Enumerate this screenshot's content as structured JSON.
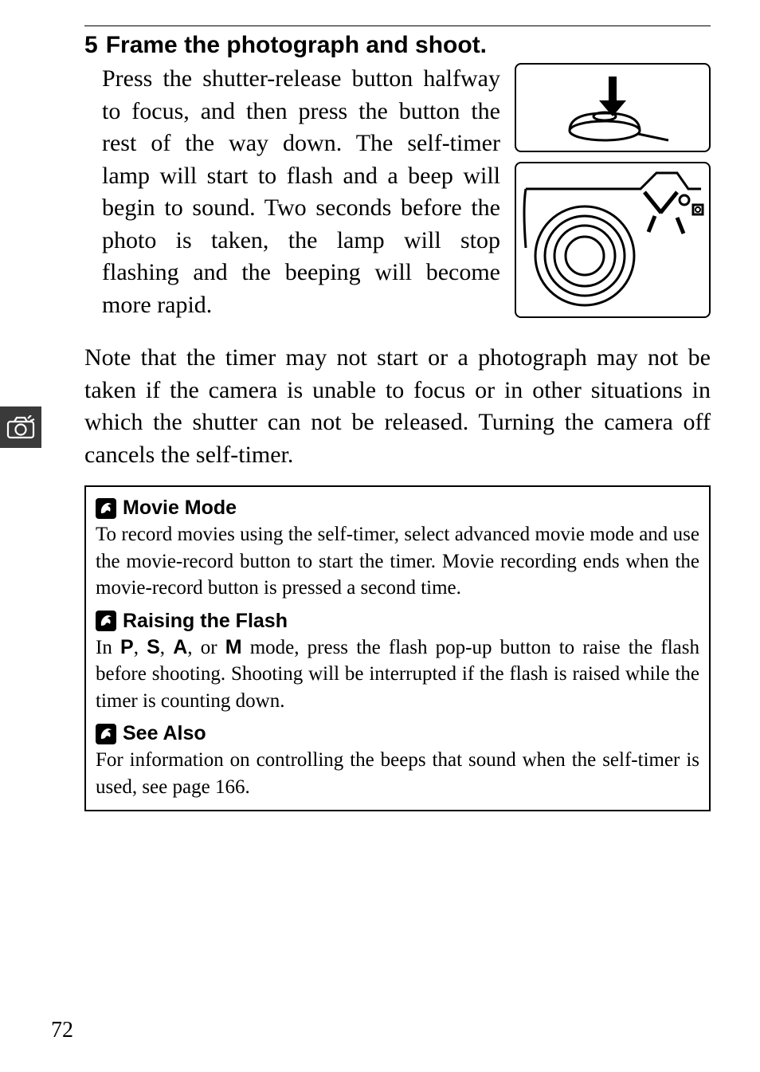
{
  "step": {
    "number": "5",
    "heading": "Frame the photograph and shoot.",
    "body": "Press the shutter-release button halfway to focus, and then press the button the rest of the way down. The self-timer lamp will start to flash and a beep will begin to sound. Two seconds before the photo is taken, the lamp will stop flashing and the beeping will become more rapid."
  },
  "note": "Note that the timer may not start or a photograph may not be taken if the camera is unable to focus or in other situations in which the shutter can not be released. Turning the camera off cancels the self-timer.",
  "info": {
    "movie": {
      "title": "Movie Mode",
      "body": "To record movies using the self-timer, select advanced movie mode and use the movie-record button to start the timer. Movie recording ends when the movie-record button is pressed a second time."
    },
    "flash": {
      "title": "Raising the Flash",
      "body_prefix": "In ",
      "m1": "P",
      "c1": ", ",
      "m2": "S",
      "c2": ", ",
      "m3": "A",
      "c3": ", or ",
      "m4": "M",
      "body_suffix": " mode, press the flash pop-up button to raise the flash before shooting. Shooting will be interrupted if the flash is raised while the timer is counting down."
    },
    "seealso": {
      "title": "See Also",
      "body": "For information on controlling the beeps that sound when the self-timer is used, see page 166."
    }
  },
  "pageNumber": "72"
}
